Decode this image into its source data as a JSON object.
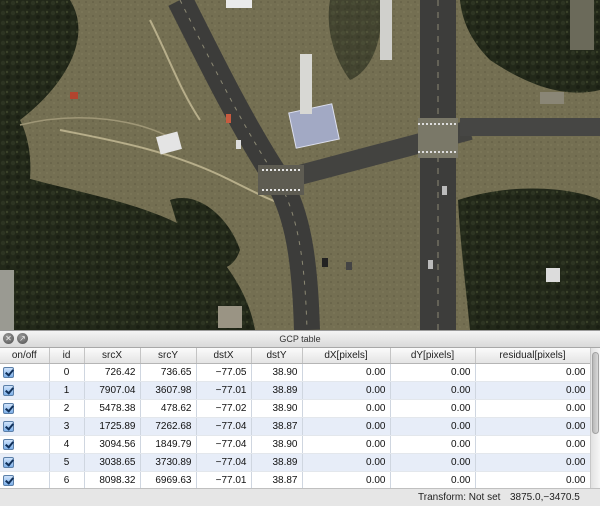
{
  "panel": {
    "title": "GCP table"
  },
  "table": {
    "columns": [
      "on/off",
      "id",
      "srcX",
      "srcY",
      "dstX",
      "dstY",
      "dX[pixels]",
      "dY[pixels]",
      "residual[pixels]"
    ],
    "rows": [
      {
        "on": true,
        "id": "0",
        "srcX": "726.42",
        "srcY": "736.65",
        "dstX": "−77.05",
        "dstY": "38.90",
        "dX": "0.00",
        "dY": "0.00",
        "residual": "0.00"
      },
      {
        "on": true,
        "id": "1",
        "srcX": "7907.04",
        "srcY": "3607.98",
        "dstX": "−77.01",
        "dstY": "38.89",
        "dX": "0.00",
        "dY": "0.00",
        "residual": "0.00"
      },
      {
        "on": true,
        "id": "2",
        "srcX": "5478.38",
        "srcY": "478.62",
        "dstX": "−77.02",
        "dstY": "38.90",
        "dX": "0.00",
        "dY": "0.00",
        "residual": "0.00"
      },
      {
        "on": true,
        "id": "3",
        "srcX": "1725.89",
        "srcY": "7262.68",
        "dstX": "−77.04",
        "dstY": "38.87",
        "dX": "0.00",
        "dY": "0.00",
        "residual": "0.00"
      },
      {
        "on": true,
        "id": "4",
        "srcX": "3094.56",
        "srcY": "1849.79",
        "dstX": "−77.04",
        "dstY": "38.90",
        "dX": "0.00",
        "dY": "0.00",
        "residual": "0.00"
      },
      {
        "on": true,
        "id": "5",
        "srcX": "3038.65",
        "srcY": "3730.89",
        "dstX": "−77.04",
        "dstY": "38.89",
        "dX": "0.00",
        "dY": "0.00",
        "residual": "0.00"
      },
      {
        "on": true,
        "id": "6",
        "srcX": "8098.32",
        "srcY": "6969.63",
        "dstX": "−77.01",
        "dstY": "38.87",
        "dX": "0.00",
        "dY": "0.00",
        "residual": "0.00"
      }
    ]
  },
  "status": {
    "transform_text": "Transform: Not set",
    "cursor_coords": "3875.0,−3470.5"
  },
  "colors": {
    "row_alt": "#e7edf8",
    "checkbox": "#7fb1ea",
    "map_ground": "#6e6a4f",
    "map_trees": "#1f2418"
  },
  "icons": [
    "close-icon",
    "float-icon",
    "checkbox-checked-icon"
  ]
}
